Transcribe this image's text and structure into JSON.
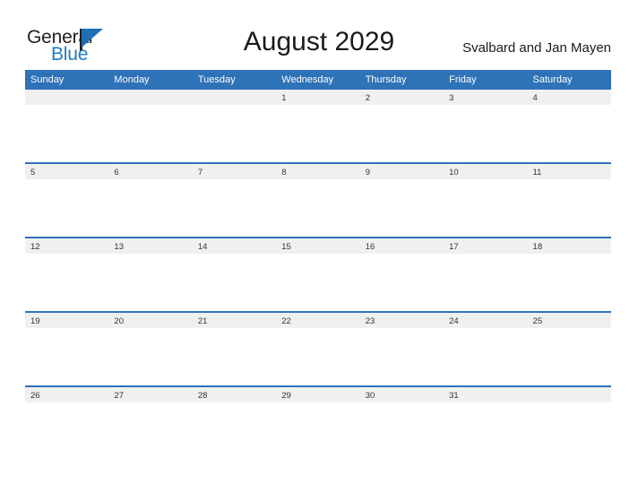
{
  "brand": {
    "word_one": "General",
    "word_two": "Blue",
    "logo_icon": "triangle-flag-icon",
    "colors": {
      "dark": "#231f20",
      "blue": "#1e7bc4"
    }
  },
  "header": {
    "title": "August 2029",
    "locale": "Svalbard and Jan Mayen"
  },
  "theme": {
    "header_blue": "#2E72B8",
    "band_gray": "#F0F0F0",
    "text_dark": "#333333"
  },
  "calendar": {
    "month": "August",
    "year": "2029",
    "weekday_headers": [
      "Sunday",
      "Monday",
      "Tuesday",
      "Wednesday",
      "Thursday",
      "Friday",
      "Saturday"
    ],
    "weeks": [
      [
        "",
        "",
        "",
        "1",
        "2",
        "3",
        "4"
      ],
      [
        "5",
        "6",
        "7",
        "8",
        "9",
        "10",
        "11"
      ],
      [
        "12",
        "13",
        "14",
        "15",
        "16",
        "17",
        "18"
      ],
      [
        "19",
        "20",
        "21",
        "22",
        "23",
        "24",
        "25"
      ],
      [
        "26",
        "27",
        "28",
        "29",
        "30",
        "31",
        ""
      ]
    ]
  }
}
